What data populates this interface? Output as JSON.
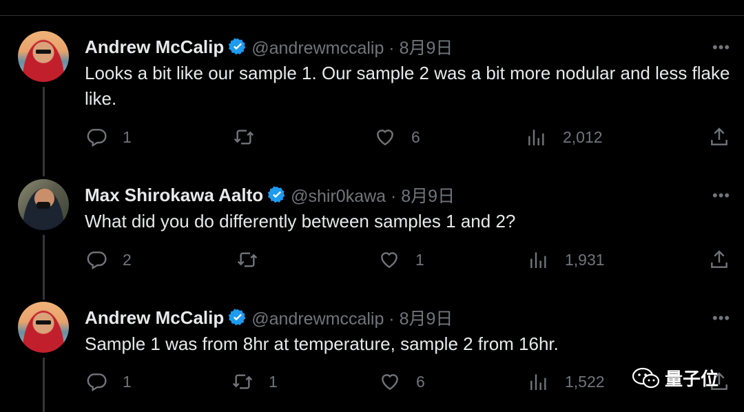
{
  "tweets": [
    {
      "name": "Andrew McCalip",
      "handle": "@andrewmccalip · 8月9日",
      "text": "Looks a bit like our sample 1. Our sample 2 was a bit more nodular and less flake like.",
      "replies": "1",
      "retweets": "",
      "likes": "6",
      "views": "2,012"
    },
    {
      "name": "Max Shirokawa Aalto",
      "handle": "@shir0kawa · 8月9日",
      "text": "What did you do differently between samples 1 and 2?",
      "replies": "2",
      "retweets": "",
      "likes": "1",
      "views": "1,931"
    },
    {
      "name": "Andrew McCalip",
      "handle": "@andrewmccalip · 8月9日",
      "text": "Sample 1 was from 8hr at temperature, sample 2 from 16hr.",
      "replies": "1",
      "retweets": "1",
      "likes": "6",
      "views": "1,522"
    }
  ],
  "more_label": "•••",
  "watermark": "量子位",
  "colors": {
    "background": "#000000",
    "text": "#e7e9ea",
    "muted": "#71767b",
    "verified": "#1d9bf0",
    "thread_line": "#333639"
  },
  "icons": [
    "verified-badge-icon",
    "reply-icon",
    "retweet-icon",
    "like-icon",
    "views-icon",
    "share-icon",
    "more-icon",
    "wechat-icon"
  ]
}
